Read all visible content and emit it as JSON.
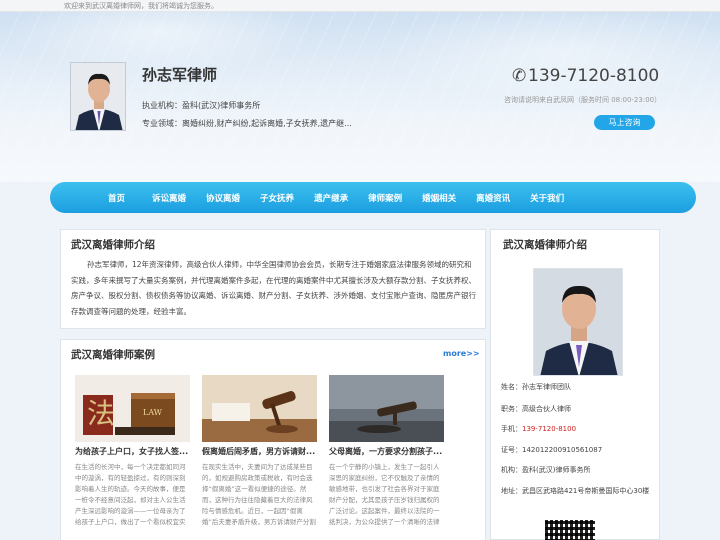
{
  "topbar": {
    "welcome": "欢迎来到武汉离婚律师网，我们将竭诚为您服务。"
  },
  "header": {
    "name": "孙志军律师",
    "org": "执业机构：盈科(武汉)律师事务所",
    "fields": "专业领域：离婚纠纷,财产纠纷,起诉离婚,子女抚养,遗产继...",
    "phone": "139-7120-8100",
    "phone_note": "咨询请说明来自武凤网（服务时间 08:00-23:00）",
    "consult_label": "马上咨询",
    "phone_icon": "phone-icon"
  },
  "nav": {
    "items": [
      "首页",
      "诉讼离婚",
      "协议离婚",
      "子女抚养",
      "遗产继承",
      "律师案例",
      "婚姻相关",
      "离婚资讯",
      "关于我们"
    ]
  },
  "intro": {
    "title": "武汉离婚律师介绍",
    "text": "孙志军律师，12年资深律师，高级合伙人律师，中华全国律师协会会员，长期专注于婚姻家庭法律服务领域的研究和实践，多年来撰写了大量实务案例，并代理离婚案件多起，在代理的离婚案件中尤其擅长涉及大额存款分割、子女抚养权、房产争议、股权分割、债权债务等协议离婚、诉讼离婚、财产分割、子女抚养、涉外婚姻、支付宝账户查询、隐匿房产银行存款调查等问题的处理，经验丰富。"
  },
  "cases": {
    "title": "武汉离婚律师案例",
    "more": "more>>",
    "items": [
      {
        "title": "为给孩子上户口，女子找人签...",
        "desc": "在生活的长河中，每一个决定都如同河中的漩涡，有的轻盈掠过，有的则深刻影响着人生的轨迹。今天的故事，便是一桩令不经意间泛起，却对主人公生活产生深远影响的漩涡——一位母亲为了给孩子上户口，做出了一个看似权宜实则危险的选择。"
      },
      {
        "title": "假离婚后闹矛盾，男方诉请财...",
        "desc": "在现实生活中，夫妻间为了达成某些目的，如规避购房政策或税收，有时会选择“假离婚”这一看似便捷的途径。然而，这种行为往往隐藏着巨大的法律风险与情感危机。近日，一起因“假离婚”后夫妻矛盾升级，男方诉请财产分割的案件引发关注。"
      },
      {
        "title": "父母离婚，一方要求分割孩子...",
        "desc": "在一个宁静的小镇上，发生了一起引人深思的家庭纠纷，它不仅触及了亲情的敏感地带，也引发了社会各界对于家庭财产分配，尤其是孩子压岁钱归属权的广泛讨论。这起案件，最终以法院的一纸判决，为公众提供了一个清晰的法律视角。"
      }
    ]
  },
  "profile": {
    "title": "武汉离婚律师介绍",
    "rows": [
      {
        "label": "姓名：",
        "value": "孙志军律师团队"
      },
      {
        "label": "职务：",
        "value": "高级合伙人律师"
      },
      {
        "label": "手机：",
        "value": "139-7120-8100"
      },
      {
        "label": "证号：",
        "value": "14201220091056108​7"
      },
      {
        "label": "机构：",
        "value": "盈科(武汉)律师事务所"
      },
      {
        "label": "地址：",
        "value": "武昌区武珞路421号帝斯曼国际中心30楼"
      }
    ]
  },
  "colors": {
    "accent": "#1b9ee0",
    "phone_red": "#d02020",
    "link": "#2a7bd2"
  }
}
